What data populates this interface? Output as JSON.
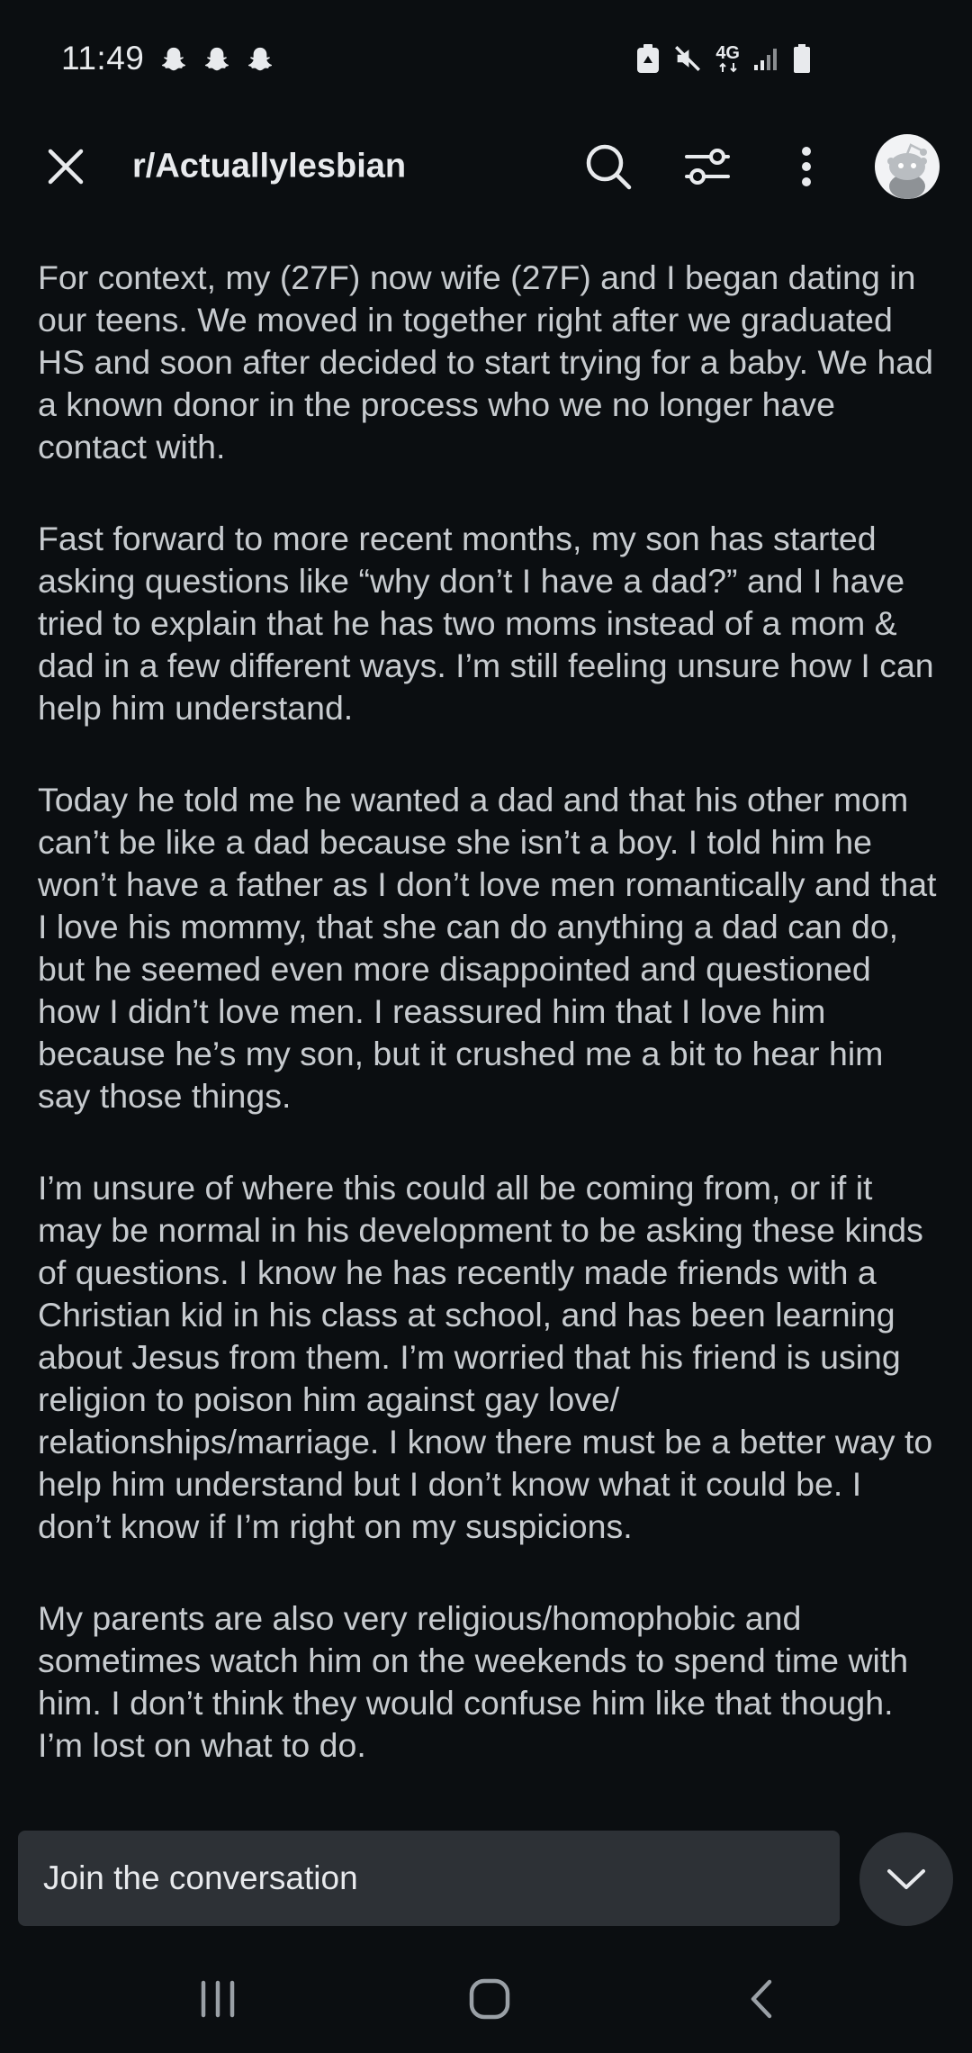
{
  "status_bar": {
    "time": "11:49",
    "notification_icons": [
      "snapchat-icon",
      "snapchat-icon",
      "snapchat-icon"
    ],
    "right_icons": [
      "recycle-icon",
      "mute-icon",
      "4g-icon",
      "signal-icon",
      "battery-icon"
    ],
    "network": "4G"
  },
  "app_bar": {
    "close_icon": "close-icon",
    "subreddit": "r/Actuallylesbian",
    "search_icon": "search-icon",
    "filter_icon": "sliders-icon",
    "more_icon": "more-vertical-icon",
    "avatar_icon": "reddit-avatar"
  },
  "post": {
    "paragraphs": [
      "For context, my (27F) now wife (27F) and I began dating in our teens. We moved in together right after we graduated HS and soon after decided to start trying for a baby. We had a known donor in the process who we no longer have contact with.",
      "Fast forward to more recent months, my son has started asking questions like “why don’t I have a dad?” and I have tried to explain that he has two moms instead of a mom & dad in a few different ways. I’m still feeling unsure how I can help him understand.",
      "Today he told me he wanted a dad and that his other mom can’t be like a dad because she isn’t a boy. I told him he won’t have a father as I don’t love men romantically and that I love his mommy, that she can do anything a dad can do, but he seemed even more disappointed and questioned how I didn’t love men. I reassured him that I love him because he’s my son, but it crushed me a bit to hear him say those things.",
      "I’m unsure of where this could all be coming from, or if it may be normal in his development to be asking these kinds of questions. I know he has recently made friends with a Christian kid in his class at school, and has been learning about Jesus from them. I’m worried that his friend is using religion to poison him against gay love/ relationships/marriage. I know there must be a better way to help him understand but I don’t know what it could be. I don’t know if I’m right on my suspicions.",
      "My parents are also very religious/homophobic and sometimes watch him on the weekends to spend time with him. I don’t think they would confuse him like that though. I’m lost on what to do."
    ]
  },
  "composer": {
    "placeholder": "Join the conversation",
    "scroll_button_icon": "chevron-down-icon"
  },
  "nav_bar": {
    "recents_icon": "recents-icon",
    "home_icon": "home-icon",
    "back_icon": "back-icon"
  },
  "colors": {
    "background": "#0b0e11",
    "text_primary": "#e8eaed",
    "text_body": "#c7cbcf",
    "surface": "#2d3136"
  }
}
